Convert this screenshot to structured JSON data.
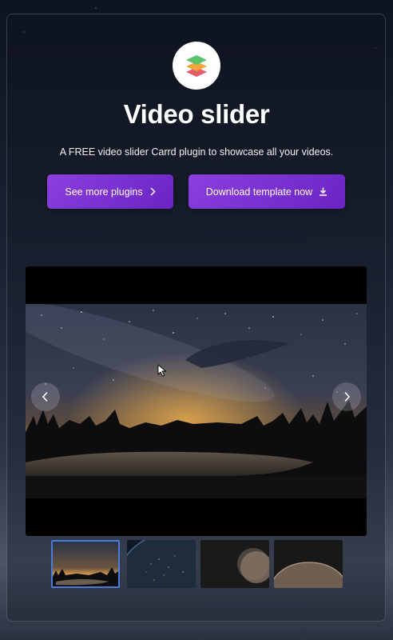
{
  "header": {
    "logo_icon": "layers-stack-icon",
    "title": "Video slider",
    "subtitle": "A FREE video slider Carrd plugin to showcase all your videos."
  },
  "buttons": {
    "plugins": {
      "label": "See more plugins",
      "icon": "chevron-right-icon"
    },
    "download": {
      "label": "Download template now",
      "icon": "download-icon"
    }
  },
  "slider": {
    "prev_icon": "chevron-left-icon",
    "next_icon": "chevron-right-icon",
    "active_index": 0,
    "thumbnails": [
      {
        "scene": "milky-way-lake"
      },
      {
        "scene": "earth-night-orbit"
      },
      {
        "scene": "planet-dark"
      },
      {
        "scene": "planet-horizon"
      }
    ]
  },
  "colors": {
    "button_gradient_start": "#8b3fe0",
    "button_gradient_end": "#6a24c4",
    "thumb_active_border": "#4a7bd6"
  }
}
